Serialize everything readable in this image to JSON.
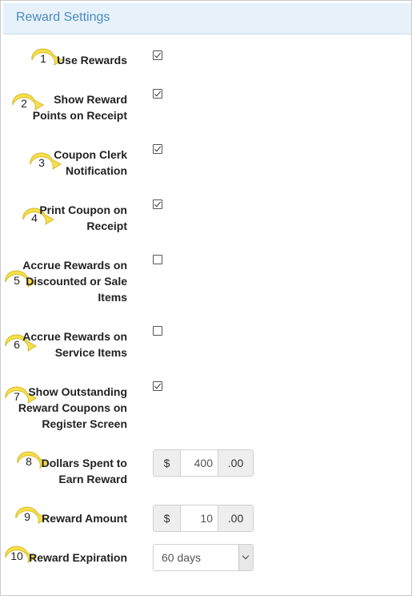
{
  "panel": {
    "title": "Reward Settings"
  },
  "settings": [
    {
      "num": "1",
      "label": "Use Rewards",
      "checked": true
    },
    {
      "num": "2",
      "label": "Show Reward\nPoints on Receipt",
      "checked": true
    },
    {
      "num": "3",
      "label": "Coupon Clerk\nNotification",
      "checked": true
    },
    {
      "num": "4",
      "label": "Print Coupon on\nReceipt",
      "checked": true
    },
    {
      "num": "5",
      "label": "Accrue Rewards on\nDiscounted or Sale\nItems",
      "checked": false
    },
    {
      "num": "6",
      "label": "Accrue Rewards on\nService Items",
      "checked": false
    },
    {
      "num": "7",
      "label": "Show Outstanding\nReward Coupons on\nRegister Screen",
      "checked": true
    },
    {
      "num": "8",
      "label": "Dollars Spent to\nEarn Reward",
      "prefix": "$",
      "value": "400",
      "suffix": ".00"
    },
    {
      "num": "9",
      "label": "Reward Amount",
      "prefix": "$",
      "value": "10",
      "suffix": ".00"
    },
    {
      "num": "10",
      "label": "Reward Expiration",
      "selected": "60 days"
    }
  ],
  "callout_color": "#f7e04b"
}
